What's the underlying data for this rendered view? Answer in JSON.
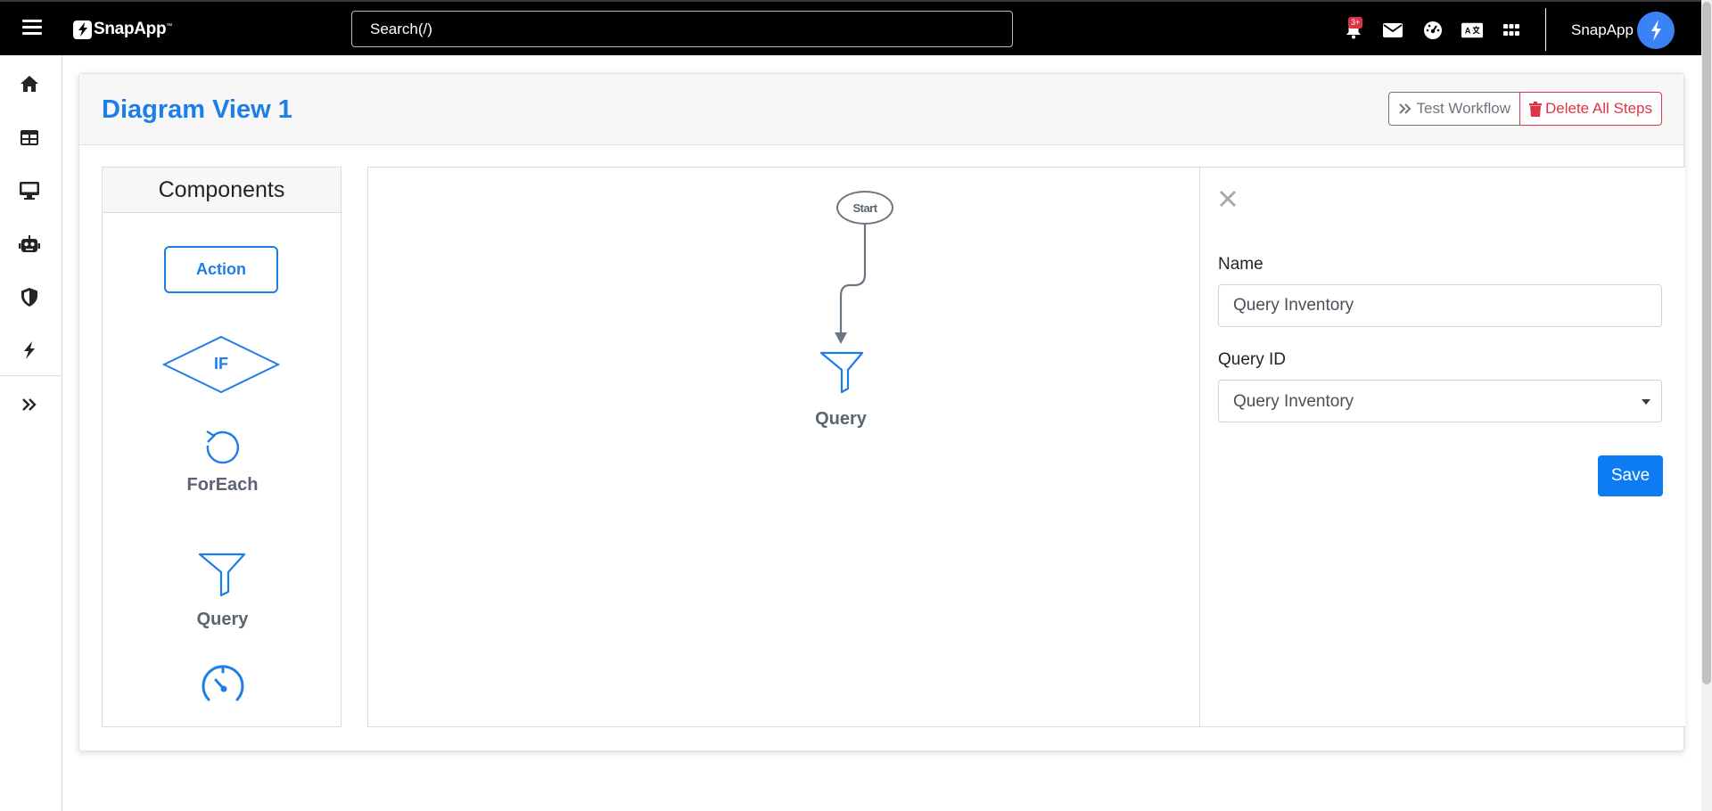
{
  "topbar": {
    "brand": "SnapApp",
    "brand_tm": "™",
    "search_placeholder": "Search(/)",
    "notification_badge": "3+",
    "username": "SnapApp"
  },
  "page": {
    "title": "Diagram View 1",
    "test_workflow_label": "Test Workflow",
    "delete_all_label": "Delete All Steps"
  },
  "components": {
    "title": "Components",
    "items": [
      {
        "label": "Action",
        "icon": "rectangle"
      },
      {
        "label": "IF",
        "icon": "diamond"
      },
      {
        "label": "ForEach",
        "icon": "loop-arrow-icon"
      },
      {
        "label": "Query",
        "icon": "funnel-icon"
      },
      {
        "label": "",
        "icon": "gauge-icon"
      }
    ]
  },
  "canvas": {
    "start_label": "Start",
    "node_label": "Query"
  },
  "properties": {
    "name_label": "Name",
    "name_value": "Query Inventory",
    "query_id_label": "Query ID",
    "query_id_value": "Query Inventory",
    "save_label": "Save"
  },
  "colors": {
    "primary": "#1e7ee8",
    "danger": "#dc3545",
    "topbar": "#000000",
    "muted": "#6c757d"
  }
}
